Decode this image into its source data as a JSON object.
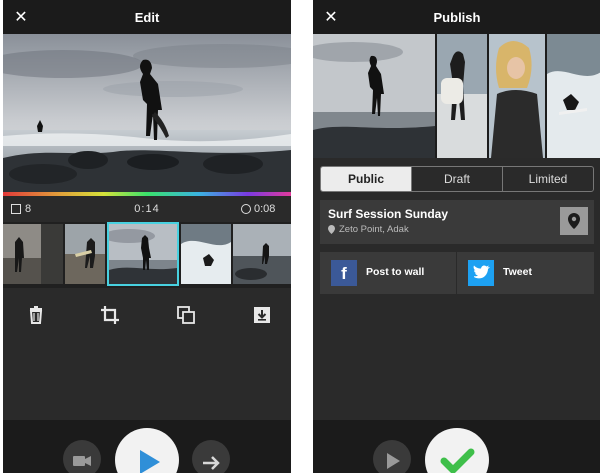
{
  "edit_screen": {
    "title": "Edit",
    "close_glyph": "✕",
    "clip_count": "8",
    "current_time": "0:14",
    "total_duration": "0:08",
    "tools": [
      "trash-icon",
      "crop-icon",
      "duplicate-icon",
      "save-to-device-icon"
    ],
    "bottom_buttons": [
      "camera-icon",
      "play-icon",
      "next-arrow-icon"
    ]
  },
  "publish_screen": {
    "title": "Publish",
    "close_glyph": "✕",
    "visibility_tabs": [
      {
        "label": "Public",
        "active": true
      },
      {
        "label": "Draft",
        "active": false
      },
      {
        "label": "Limited",
        "active": false
      }
    ],
    "video_title": "Surf Session Sunday",
    "location": "Zeto Point, Adak",
    "share": {
      "facebook_label": "Post to wall",
      "facebook_glyph": "f",
      "twitter_label": "Tweet"
    },
    "bottom_buttons": [
      "play-icon",
      "publish-check-icon"
    ]
  },
  "colors": {
    "panel_bg": "#2a2a2a",
    "bar_bg": "#1b1b1b",
    "selection": "#48d1e0",
    "publish_green": "#3fbf4a",
    "facebook": "#3b5998",
    "twitter": "#1da1f2"
  }
}
